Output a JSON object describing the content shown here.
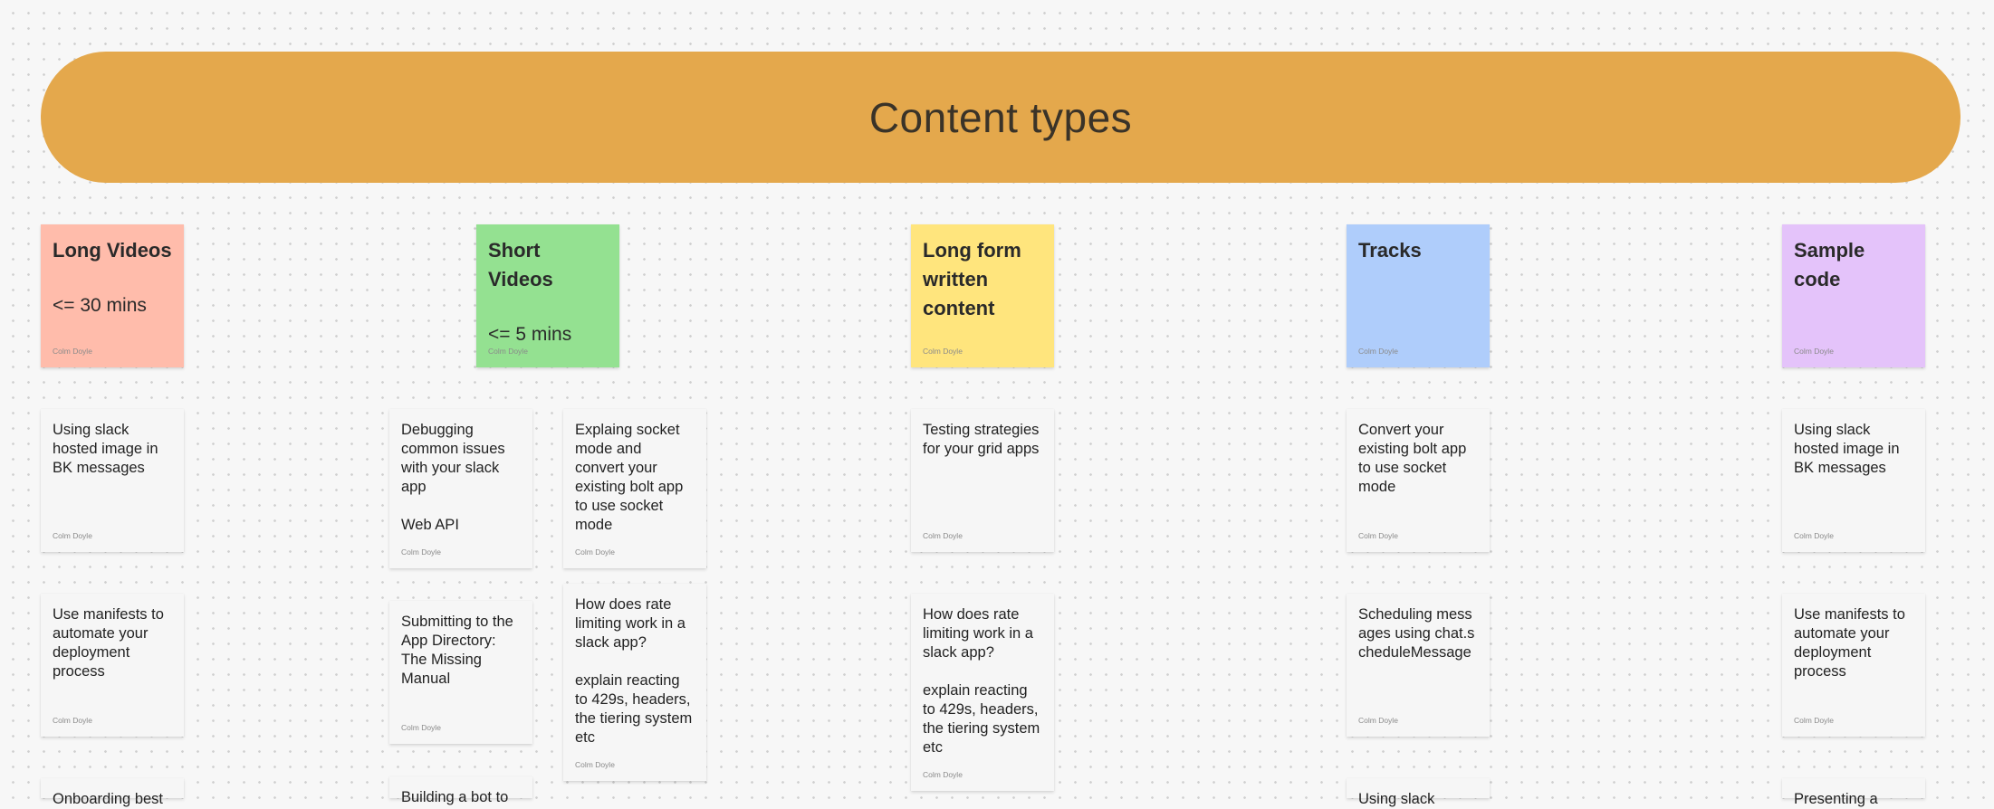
{
  "board": {
    "title": "Content types"
  },
  "author": "Colm Doyle",
  "columns": [
    {
      "title": "Long Videos",
      "subtitle": "<= 30 mins"
    },
    {
      "title": "Short Videos",
      "subtitle": "<= 5 mins"
    },
    {
      "title": "Long form written content",
      "subtitle": ""
    },
    {
      "title": "Tracks",
      "subtitle": ""
    },
    {
      "title": "Sample code",
      "subtitle": ""
    }
  ],
  "cards": {
    "long_videos": [
      "Using slack hosted image in BK messages",
      "Use manifests to automate your deployment process",
      "Onboarding best"
    ],
    "short_videos_a": [
      "Debugging common issues with your slack app\n\nWeb API",
      "Submitting to the App Directory: The Missing Manual",
      "Building a bot to"
    ],
    "short_videos_b": [
      "Explaing socket mode and convert your existing bolt app to use socket mode",
      "How does rate limiting work in a slack app?\n\nexplain reacting to 429s, headers, the tiering system etc"
    ],
    "long_form": [
      "Testing strategies for your grid apps",
      "How does rate limiting work in a slack app?\n\nexplain reacting to 429s, headers, the tiering system etc"
    ],
    "tracks": [
      "Convert your existing bolt app to use socket mode",
      "Scheduling messages using chat.scheduleMessage",
      "Using slack"
    ],
    "sample_code": [
      "Using slack hosted image in BK messages",
      "Use manifests to automate your deployment process",
      "Presenting a"
    ]
  }
}
